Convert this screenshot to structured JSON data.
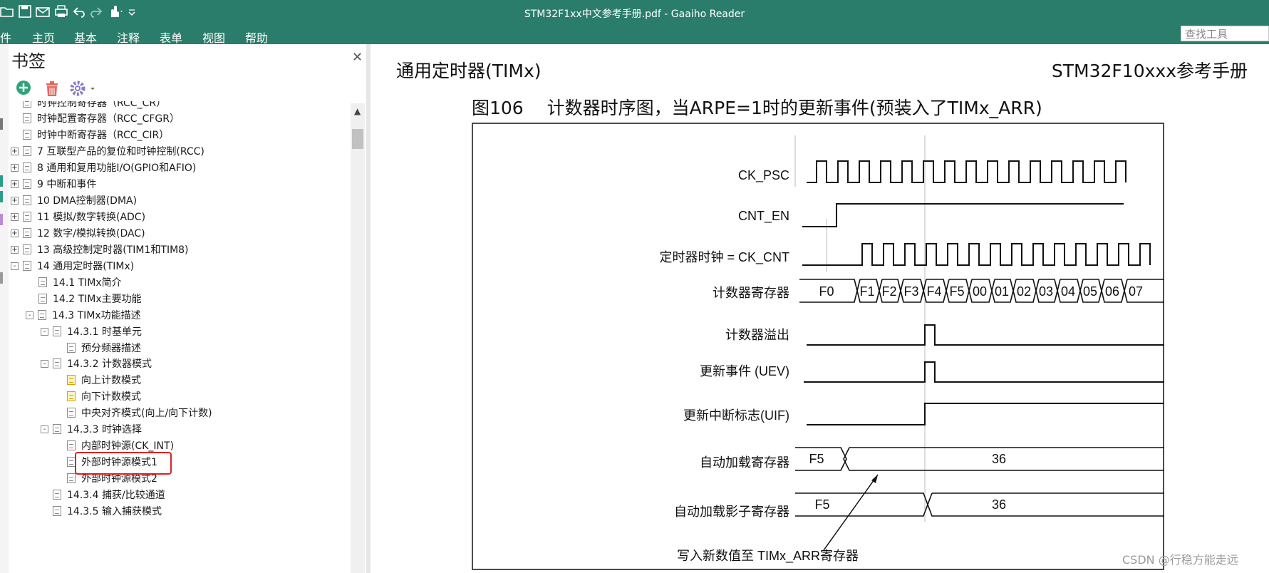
{
  "window": {
    "title": "STM32F1xx中文参考手册.pdf - Gaaiho Reader"
  },
  "menu": {
    "items": [
      "件",
      "主页",
      "基本",
      "注释",
      "表单",
      "视图",
      "帮助"
    ]
  },
  "search": {
    "placeholder": "查找工具"
  },
  "bookmarks": {
    "title": "书签",
    "items": [
      {
        "label": "时钟控制寄存器（RCC_CR）",
        "level": 0,
        "expander": ""
      },
      {
        "label": "时钟配置寄存器（RCC_CFGR）",
        "level": 0,
        "expander": ""
      },
      {
        "label": "时钟中断寄存器（RCC_CIR）",
        "level": 0,
        "expander": ""
      },
      {
        "label": "7 互联型产品的复位和时钟控制(RCC)",
        "level": 0,
        "expander": "+"
      },
      {
        "label": "8 通用和复用功能I/O(GPIO和AFIO)",
        "level": 0,
        "expander": "+"
      },
      {
        "label": "9 中断和事件",
        "level": 0,
        "expander": "+"
      },
      {
        "label": "10 DMA控制器(DMA)",
        "level": 0,
        "expander": "+"
      },
      {
        "label": "11 模拟/数字转换(ADC)",
        "level": 0,
        "expander": "+"
      },
      {
        "label": "12 数字/模拟转换(DAC)",
        "level": 0,
        "expander": "+"
      },
      {
        "label": "13 高级控制定时器(TIM1和TIM8)",
        "level": 0,
        "expander": "+"
      },
      {
        "label": "14 通用定时器(TIMx)",
        "level": 0,
        "expander": "-"
      },
      {
        "label": "14.1 TIMx简介",
        "level": 1,
        "expander": ""
      },
      {
        "label": "14.2 TIMx主要功能",
        "level": 1,
        "expander": ""
      },
      {
        "label": "14.3 TIMx功能描述",
        "level": 1,
        "expander": "-"
      },
      {
        "label": "14.3.1 时基单元",
        "level": 2,
        "expander": "-"
      },
      {
        "label": "预分频器描述",
        "level": 3,
        "expander": ""
      },
      {
        "label": "14.3.2 计数器模式",
        "level": 2,
        "expander": "-"
      },
      {
        "label": "向上计数模式",
        "level": 3,
        "expander": "",
        "selected": true
      },
      {
        "label": "向下计数模式",
        "level": 3,
        "expander": "",
        "selected": true
      },
      {
        "label": "中央对齐模式(向上/向下计数)",
        "level": 3,
        "expander": ""
      },
      {
        "label": "14.3.3 时钟选择",
        "level": 2,
        "expander": "-"
      },
      {
        "label": "内部时钟源(CK_INT)",
        "level": 3,
        "expander": ""
      },
      {
        "label": "外部时钟源模式1",
        "level": 3,
        "expander": ""
      },
      {
        "label": "外部时钟源模式2",
        "level": 3,
        "expander": ""
      },
      {
        "label": "14.3.4 捕获/比较通道",
        "level": 2,
        "expander": ""
      },
      {
        "label": "14.3.5 输入捕获模式",
        "level": 2,
        "expander": ""
      }
    ]
  },
  "page": {
    "header_left": "通用定时器(TIMx)",
    "header_right": "STM32F10xxx参考手册",
    "figure_caption": "图106　 计数器时序图，当ARPE=1时的更新事件(预装入了TIMx_ARR)"
  },
  "timing": {
    "signals": [
      "CK_PSC",
      "CNT_EN",
      "定时器时钟 = CK_CNT",
      "计数器寄存器",
      "计数器溢出",
      "更新事件 (UEV)",
      "更新中断标志(UIF)",
      "自动加载寄存器",
      "自动加载影子寄存器"
    ],
    "counter_values": [
      "F0",
      "F1",
      "F2",
      "F3",
      "F4",
      "F5",
      "00",
      "01",
      "02",
      "03",
      "04",
      "05",
      "06",
      "07"
    ],
    "autoreload_values": [
      "F5",
      "36"
    ],
    "shadow_values": [
      "F5",
      "36"
    ],
    "annotation": "写入新数值至 TIMx_ARR寄存器"
  },
  "watermark": "CSDN @行稳方能走远",
  "colors": {
    "titlebar": "#2b7d6b",
    "highlight": "#e02020"
  }
}
